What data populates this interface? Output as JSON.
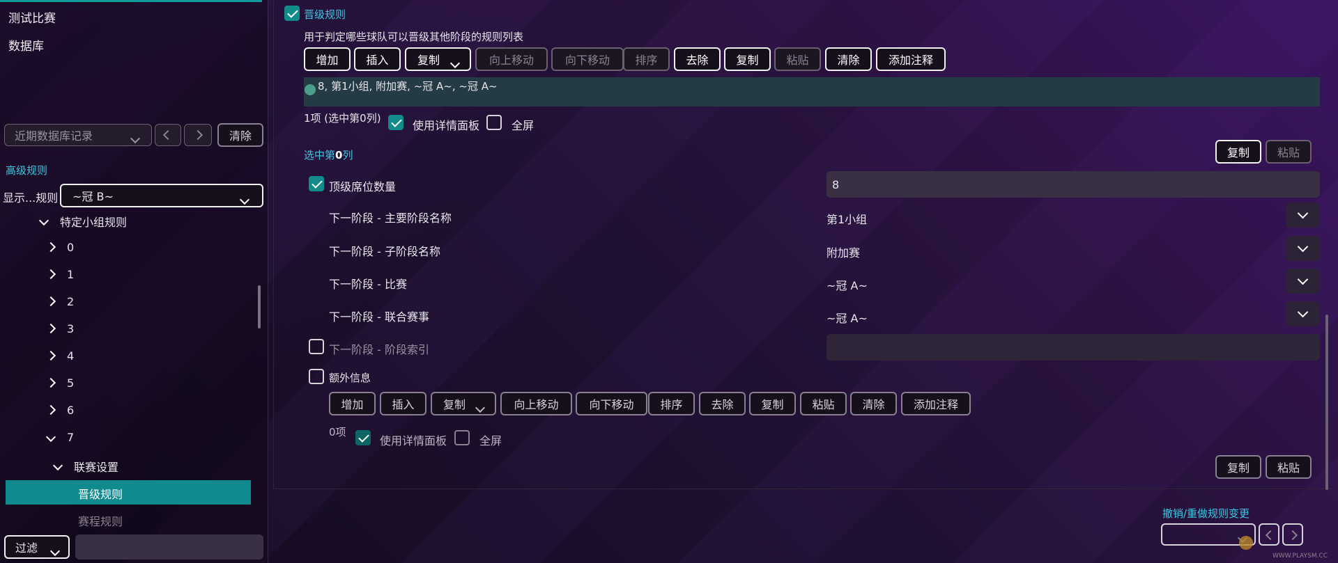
{
  "sidebar": {
    "nav": [
      "测试比赛",
      "数据库"
    ],
    "recent_db_placeholder": "近期数据库记录",
    "clear": "清除",
    "advanced_rules": "高级规则",
    "show_rules_label": "显示...规则",
    "show_rules_value": "~冠 B~",
    "tree": {
      "group_rules": "特定小组规则",
      "indices": [
        "0",
        "1",
        "2",
        "3",
        "4",
        "5",
        "6",
        "7"
      ],
      "league_settings": "联赛设置",
      "promotion_rules": "晋级规则",
      "schedule_rules": "赛程规则"
    },
    "filter": "过滤"
  },
  "main": {
    "promotion_title": "晋级规则",
    "description": "用于判定哪些球队可以晋级其他阶段的规则列表",
    "toolbar": [
      "增加",
      "插入",
      "复制",
      "向上移动",
      "向下移动",
      "排序",
      "去除",
      "复制",
      "粘贴",
      "清除",
      "添加注释"
    ],
    "list_item": "8, 第1小组, 附加赛, ~冠 A~, ~冠 A~",
    "count": "1项 (选中第0列)",
    "use_detail_panel": "使用详情面板",
    "fullscreen": "全屏",
    "selected_prefix": "选中第",
    "selected_index": "0",
    "selected_suffix": "列",
    "copy": "复制",
    "paste": "粘贴",
    "fields": {
      "top_seats": {
        "label": "顶级席位数量",
        "value": "8"
      },
      "next_main_stage": {
        "label": "下一阶段 - 主要阶段名称",
        "value": "第1小组"
      },
      "next_sub_stage": {
        "label": "下一阶段 - 子阶段名称",
        "value": "附加赛"
      },
      "next_match": {
        "label": "下一阶段 - 比赛",
        "value": "~冠 A~"
      },
      "next_league": {
        "label": "下一阶段 - 联合赛事",
        "value": "~冠 A~"
      },
      "next_stage_index": {
        "label": "下一阶段 - 阶段索引",
        "value": ""
      },
      "extra_info": {
        "label": "额外信息"
      }
    },
    "extra_count": "0项",
    "undo_redo": "撤销/重做规则变更",
    "watermark": "WWW.PLAYSM.CC"
  },
  "colors": {
    "accent": "#118c8a",
    "selected_bg": "#0f8a8f",
    "link": "#3fc6e0"
  }
}
